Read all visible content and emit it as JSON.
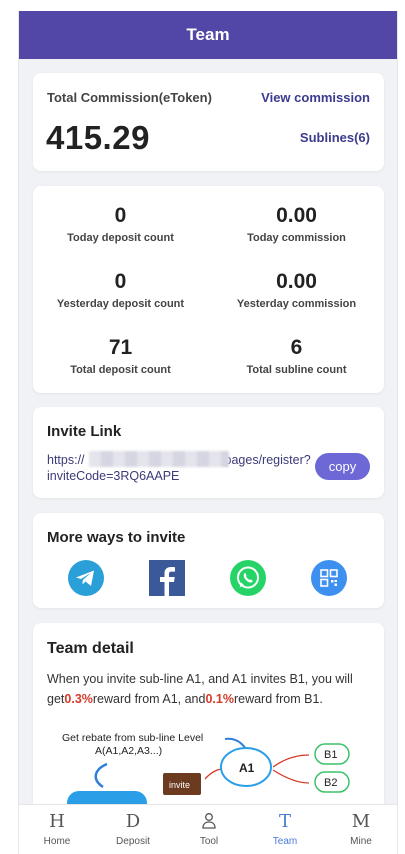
{
  "header": {
    "title": "Team"
  },
  "commission": {
    "label": "Total Commission(eToken)",
    "view_label": "View commission",
    "amount": "415.29",
    "sublines_label": "Sublines(6)"
  },
  "stats": [
    {
      "value": "0",
      "caption": "Today deposit count"
    },
    {
      "value": "0.00",
      "caption": "Today commission"
    },
    {
      "value": "0",
      "caption": "Yesterday deposit count"
    },
    {
      "value": "0.00",
      "caption": "Yesterday commission"
    },
    {
      "value": "71",
      "caption": "Total deposit count"
    },
    {
      "value": "6",
      "caption": "Total subline count"
    }
  ],
  "invite": {
    "title": "Invite Link",
    "link_start": "https://",
    "link_end": "pages/register?inviteCode=3RQ6AAPE",
    "copy_label": "copy"
  },
  "more_ways": {
    "title": "More ways to invite",
    "icons": [
      "telegram-icon",
      "facebook-icon",
      "whatsapp-icon",
      "qrcode-icon"
    ],
    "colors": {
      "telegram": "#2a9fd8",
      "facebook": "#3b5998",
      "whatsapp": "#25d366",
      "qrcode": "#3d8ff0"
    }
  },
  "team_detail": {
    "title": "Team detail",
    "text_1": "When you invite sub-line A1, and A1 invites B1, you will get",
    "pct_1": "0.3%",
    "text_2": "reward from A1, and",
    "pct_2": "0.1%",
    "text_3": "reward from B1.",
    "diagram": {
      "caption_1": "Get rebate from sub-line Level",
      "caption_2": "A(A1,A2,A3...)",
      "invite_label": "invite",
      "node_a1": "A1",
      "node_b1": "B1",
      "node_b2": "B2"
    }
  },
  "tabbar": [
    {
      "icon": "H",
      "label": "Home"
    },
    {
      "icon": "D",
      "label": "Deposit"
    },
    {
      "icon": "person-icon",
      "label": "Tool"
    },
    {
      "icon": "T",
      "label": "Team",
      "active": true
    },
    {
      "icon": "M",
      "label": "Mine"
    }
  ],
  "colors": {
    "header": "#5246a6",
    "accent": "#6d68d6",
    "active_tab": "#4a7bd8",
    "highlight": "#d43a2a"
  }
}
